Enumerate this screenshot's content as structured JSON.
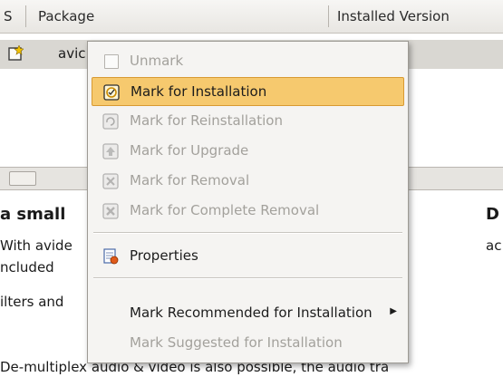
{
  "table": {
    "columns": [
      "S",
      "Package",
      "Installed Version"
    ],
    "row": {
      "name_fragment": "avic",
      "icon": "package-star-icon"
    }
  },
  "description": {
    "title_fragment": "a small",
    "title_right": "D",
    "line1": "With avide",
    "line1_right": "ac",
    "line2": "ncluded",
    "line3": "ilters and",
    "line4": "De-multiplex audio & video is also possible, the audio tra"
  },
  "menu": {
    "items": [
      {
        "label": "Unmark",
        "icon": "checkbox-icon",
        "enabled": false
      },
      {
        "label": "Mark for Installation",
        "icon": "install-icon",
        "enabled": true,
        "highlighted": true
      },
      {
        "label": "Mark for Reinstallation",
        "icon": "reinstall-icon",
        "enabled": false
      },
      {
        "label": "Mark for Upgrade",
        "icon": "upgrade-icon",
        "enabled": false
      },
      {
        "label": "Mark for Removal",
        "icon": "remove-icon",
        "enabled": false
      },
      {
        "label": "Mark for Complete Removal",
        "icon": "purge-icon",
        "enabled": false
      },
      {
        "label": "Properties",
        "icon": "properties-icon",
        "enabled": true
      },
      {
        "label": "Mark Recommended for Installation",
        "icon": "",
        "enabled": true,
        "submenu": true
      },
      {
        "label": "Mark Suggested for Installation",
        "icon": "",
        "enabled": false
      }
    ]
  },
  "colors": {
    "highlight": "#f6c96e",
    "highlight_border": "#d89a33",
    "menu_bg": "#f5f4f2",
    "disabled_text": "#a3a19c"
  }
}
